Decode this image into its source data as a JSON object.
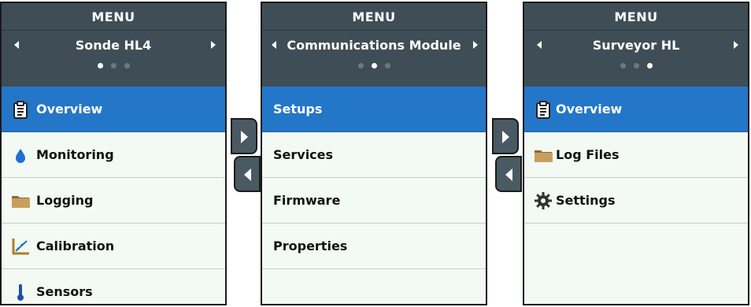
{
  "panels": [
    {
      "menu_title": "MENU",
      "device": "Sonde HL4",
      "page_count": 3,
      "active_page": 1,
      "items": [
        {
          "label": "Overview",
          "icon": "clipboard-icon",
          "selected": true
        },
        {
          "label": "Monitoring",
          "icon": "water-drop-icon",
          "selected": false
        },
        {
          "label": "Logging",
          "icon": "folder-icon",
          "selected": false
        },
        {
          "label": "Calibration",
          "icon": "calibration-chart-icon",
          "selected": false
        },
        {
          "label": "Sensors",
          "icon": "thermometer-icon",
          "selected": false
        }
      ]
    },
    {
      "menu_title": "MENU",
      "device": "Communications Module",
      "page_count": 3,
      "active_page": 2,
      "items": [
        {
          "label": "Setups",
          "selected": true
        },
        {
          "label": "Services",
          "selected": false
        },
        {
          "label": "Firmware",
          "selected": false
        },
        {
          "label": "Properties",
          "selected": false
        }
      ]
    },
    {
      "menu_title": "MENU",
      "device": "Surveyor HL",
      "page_count": 3,
      "active_page": 3,
      "items": [
        {
          "label": "Overview",
          "icon": "clipboard-icon",
          "selected": true
        },
        {
          "label": "Log Files",
          "icon": "folder-icon",
          "selected": false
        },
        {
          "label": "Settings",
          "icon": "gear-icon",
          "selected": false
        }
      ]
    }
  ],
  "colors": {
    "header": "#3f4e56",
    "selected": "#2476c9",
    "list_bg": "#f3f9f3"
  }
}
